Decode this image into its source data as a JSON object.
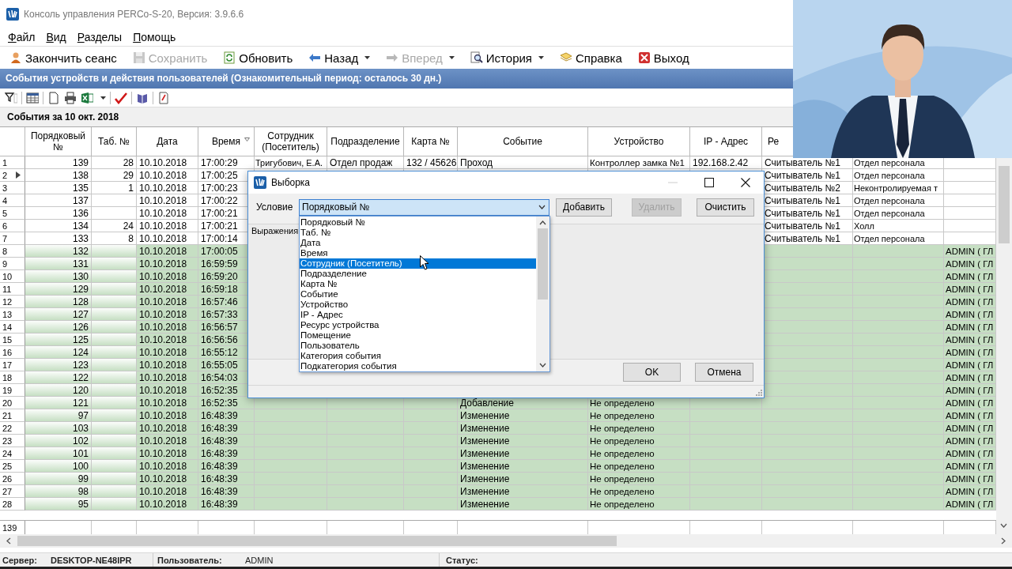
{
  "window": {
    "title": "Консоль управления PERCo-S-20, Версия: 3.9.6.6"
  },
  "menu": [
    "Файл",
    "Вид",
    "Разделы",
    "Помощь"
  ],
  "toolbar": [
    {
      "label": "Закончить сеанс",
      "kind": "user",
      "disabled": false,
      "dropdown": false
    },
    {
      "label": "Сохранить",
      "kind": "save",
      "disabled": true,
      "dropdown": false
    },
    {
      "label": "Обновить",
      "kind": "refresh",
      "disabled": false,
      "dropdown": false
    },
    {
      "label": "Назад",
      "kind": "back",
      "disabled": false,
      "dropdown": true
    },
    {
      "label": "Вперед",
      "kind": "forward",
      "disabled": true,
      "dropdown": true
    },
    {
      "label": "История",
      "kind": "history",
      "disabled": false,
      "dropdown": true
    },
    {
      "label": "Справка",
      "kind": "help",
      "disabled": false,
      "dropdown": false
    },
    {
      "label": "Выход",
      "kind": "exit",
      "disabled": false,
      "dropdown": false
    }
  ],
  "banner": "События устройств и действия пользователей (Ознакомительный период: осталось 30 дн.)",
  "caption": "События за 10 окт. 2018",
  "table": {
    "columns": [
      {
        "label": "Порядковый №"
      },
      {
        "label": "Таб. №"
      },
      {
        "label": "Дата"
      },
      {
        "label": "Время",
        "sorted": true
      },
      {
        "label": "Сотрудник (Посетитель)"
      },
      {
        "label": "Подразделение"
      },
      {
        "label": "Карта №"
      },
      {
        "label": "Событие"
      },
      {
        "label": "Устройство"
      },
      {
        "label": "IP - Адрес"
      },
      {
        "label": "Ре"
      },
      {},
      {}
    ],
    "rows": [
      {
        "number": "1",
        "highlighted": false,
        "current": false,
        "cells": [
          "139",
          "28",
          "10.10.2018",
          "17:00:29",
          "Тригубович, Е.А.",
          "Отдел продаж",
          "132 / 45626",
          "Проход",
          "Контроллер замка №1",
          "192.168.2.42",
          "Считыватель №1",
          "Отдел персонала",
          null
        ]
      },
      {
        "number": "2",
        "highlighted": false,
        "current": true,
        "cells": [
          "138",
          "29",
          "10.10.2018",
          "17:00:25",
          null,
          null,
          null,
          null,
          null,
          null,
          "Считыватель №1",
          "Отдел персонала",
          null
        ]
      },
      {
        "number": "3",
        "highlighted": false,
        "current": false,
        "cells": [
          "135",
          "1",
          "10.10.2018",
          "17:00:23",
          null,
          null,
          null,
          null,
          null,
          null,
          "Считыватель №2",
          "Неконтролируемая т",
          null
        ]
      },
      {
        "number": "4",
        "highlighted": false,
        "current": false,
        "cells": [
          "137",
          null,
          "10.10.2018",
          "17:00:22",
          null,
          null,
          null,
          null,
          null,
          null,
          "Считыватель №1",
          "Отдел персонала",
          null
        ]
      },
      {
        "number": "5",
        "highlighted": false,
        "current": false,
        "cells": [
          "136",
          null,
          "10.10.2018",
          "17:00:21",
          null,
          null,
          null,
          null,
          null,
          null,
          "Считыватель №1",
          "Отдел персонала",
          null
        ]
      },
      {
        "number": "6",
        "highlighted": false,
        "current": false,
        "cells": [
          "134",
          "24",
          "10.10.2018",
          "17:00:21",
          null,
          null,
          null,
          null,
          null,
          null,
          "Считыватель №1",
          "Холл",
          null
        ]
      },
      {
        "number": "7",
        "highlighted": false,
        "current": false,
        "cells": [
          "133",
          "8",
          "10.10.2018",
          "17:00:14",
          null,
          null,
          null,
          null,
          null,
          null,
          "Считыватель №1",
          "Отдел персонала",
          null
        ]
      },
      {
        "number": "8",
        "highlighted": true,
        "current": false,
        "cells": [
          "132",
          null,
          "10.10.2018",
          "17:00:05",
          null,
          null,
          null,
          null,
          null,
          null,
          null,
          null,
          "ADMIN ( ГЛ"
        ]
      },
      {
        "number": "9",
        "highlighted": true,
        "current": false,
        "cells": [
          "131",
          null,
          "10.10.2018",
          "16:59:59",
          null,
          null,
          null,
          null,
          null,
          null,
          null,
          null,
          "ADMIN ( ГЛ"
        ]
      },
      {
        "number": "10",
        "highlighted": true,
        "current": false,
        "cells": [
          "130",
          null,
          "10.10.2018",
          "16:59:20",
          null,
          null,
          null,
          null,
          null,
          null,
          null,
          null,
          "ADMIN ( ГЛ"
        ]
      },
      {
        "number": "11",
        "highlighted": true,
        "current": false,
        "cells": [
          "129",
          null,
          "10.10.2018",
          "16:59:18",
          null,
          null,
          null,
          null,
          null,
          null,
          null,
          null,
          "ADMIN ( ГЛ"
        ]
      },
      {
        "number": "12",
        "highlighted": true,
        "current": false,
        "cells": [
          "128",
          null,
          "10.10.2018",
          "16:57:46",
          null,
          null,
          null,
          null,
          null,
          null,
          null,
          null,
          "ADMIN ( ГЛ"
        ]
      },
      {
        "number": "13",
        "highlighted": true,
        "current": false,
        "cells": [
          "127",
          null,
          "10.10.2018",
          "16:57:33",
          null,
          null,
          null,
          null,
          null,
          null,
          null,
          null,
          "ADMIN ( ГЛ"
        ]
      },
      {
        "number": "14",
        "highlighted": true,
        "current": false,
        "cells": [
          "126",
          null,
          "10.10.2018",
          "16:56:57",
          null,
          null,
          null,
          null,
          null,
          null,
          null,
          null,
          "ADMIN ( ГЛ"
        ]
      },
      {
        "number": "15",
        "highlighted": true,
        "current": false,
        "cells": [
          "125",
          null,
          "10.10.2018",
          "16:56:56",
          null,
          null,
          null,
          null,
          null,
          null,
          null,
          null,
          "ADMIN ( ГЛ"
        ]
      },
      {
        "number": "16",
        "highlighted": true,
        "current": false,
        "cells": [
          "124",
          null,
          "10.10.2018",
          "16:55:12",
          null,
          null,
          null,
          null,
          null,
          null,
          null,
          null,
          "ADMIN ( ГЛ"
        ]
      },
      {
        "number": "17",
        "highlighted": true,
        "current": false,
        "cells": [
          "123",
          null,
          "10.10.2018",
          "16:55:05",
          null,
          null,
          null,
          null,
          null,
          null,
          null,
          null,
          "ADMIN ( ГЛ"
        ]
      },
      {
        "number": "18",
        "highlighted": true,
        "current": false,
        "cells": [
          "122",
          null,
          "10.10.2018",
          "16:54:03",
          null,
          null,
          null,
          null,
          null,
          null,
          null,
          null,
          "ADMIN ( ГЛ"
        ]
      },
      {
        "number": "19",
        "highlighted": true,
        "current": false,
        "cells": [
          "120",
          null,
          "10.10.2018",
          "16:52:35",
          null,
          null,
          null,
          null,
          null,
          null,
          null,
          null,
          "ADMIN ( ГЛ"
        ]
      },
      {
        "number": "20",
        "highlighted": true,
        "current": false,
        "cells": [
          "121",
          null,
          "10.10.2018",
          "16:52:35",
          null,
          null,
          null,
          "Добавление",
          "Не определено",
          null,
          null,
          null,
          "ADMIN ( ГЛ"
        ]
      },
      {
        "number": "21",
        "highlighted": true,
        "current": false,
        "cells": [
          "97",
          null,
          "10.10.2018",
          "16:48:39",
          null,
          null,
          null,
          "Изменение",
          "Не определено",
          null,
          null,
          null,
          "ADMIN ( ГЛ"
        ]
      },
      {
        "number": "22",
        "highlighted": true,
        "current": false,
        "cells": [
          "103",
          null,
          "10.10.2018",
          "16:48:39",
          null,
          null,
          null,
          "Изменение",
          "Не определено",
          null,
          null,
          null,
          "ADMIN ( ГЛ"
        ]
      },
      {
        "number": "23",
        "highlighted": true,
        "current": false,
        "cells": [
          "102",
          null,
          "10.10.2018",
          "16:48:39",
          null,
          null,
          null,
          "Изменение",
          "Не определено",
          null,
          null,
          null,
          "ADMIN ( ГЛ"
        ]
      },
      {
        "number": "24",
        "highlighted": true,
        "current": false,
        "cells": [
          "101",
          null,
          "10.10.2018",
          "16:48:39",
          null,
          null,
          null,
          "Изменение",
          "Не определено",
          null,
          null,
          null,
          "ADMIN ( ГЛ"
        ]
      },
      {
        "number": "25",
        "highlighted": true,
        "current": false,
        "cells": [
          "100",
          null,
          "10.10.2018",
          "16:48:39",
          null,
          null,
          null,
          "Изменение",
          "Не определено",
          null,
          null,
          null,
          "ADMIN ( ГЛ"
        ]
      },
      {
        "number": "26",
        "highlighted": true,
        "current": false,
        "cells": [
          "99",
          null,
          "10.10.2018",
          "16:48:39",
          null,
          null,
          null,
          "Изменение",
          "Не определено",
          null,
          null,
          null,
          "ADMIN ( ГЛ"
        ]
      },
      {
        "number": "27",
        "highlighted": true,
        "current": false,
        "cells": [
          "98",
          null,
          "10.10.2018",
          "16:48:39",
          null,
          null,
          null,
          "Изменение",
          "Не определено",
          null,
          null,
          null,
          "ADMIN ( ГЛ"
        ]
      },
      {
        "number": "28",
        "highlighted": true,
        "current": false,
        "cells": [
          "95",
          null,
          "10.10.2018",
          "16:48:39",
          null,
          null,
          null,
          "Изменение",
          "Не определено",
          null,
          null,
          null,
          "ADMIN ( ГЛ"
        ]
      }
    ],
    "footer": "139"
  },
  "status_bar": [
    {
      "label": "Сервер:",
      "value": "DESKTOP-NE48IPR"
    },
    {
      "label": "Пользователь:",
      "value": "ADMIN"
    },
    {
      "label": "Статус:"
    }
  ],
  "dialog": {
    "title": "Выборка",
    "condition_label": "Условие",
    "condition_value": "Порядковый №",
    "options": [
      {
        "label": "Порядковый №",
        "selected": false
      },
      {
        "label": "Таб. №",
        "selected": false
      },
      {
        "label": "Дата",
        "selected": false
      },
      {
        "label": "Время",
        "selected": false
      },
      {
        "label": "Сотрудник (Посетитель)",
        "selected": true
      },
      {
        "label": "Подразделение",
        "selected": false
      },
      {
        "label": "Карта №",
        "selected": false
      },
      {
        "label": "Событие",
        "selected": false
      },
      {
        "label": "Устройство",
        "selected": false
      },
      {
        "label": "IP - Адрес",
        "selected": false
      },
      {
        "label": "Ресурс устройства",
        "selected": false
      },
      {
        "label": "Помещение",
        "selected": false
      },
      {
        "label": "Пользователь",
        "selected": false
      },
      {
        "label": "Категория события",
        "selected": false
      },
      {
        "label": "Подкатегория события",
        "selected": false
      }
    ],
    "top_buttons": [
      {
        "label": "Добавить",
        "disabled": false
      },
      {
        "label": "Удалить",
        "disabled": true
      },
      {
        "label": "Очистить",
        "disabled": false
      }
    ],
    "expressions_label": "Выражения",
    "bottom_buttons": [
      {
        "label": "OK",
        "disabled": false
      },
      {
        "label": "Отмена",
        "disabled": false
      }
    ]
  }
}
